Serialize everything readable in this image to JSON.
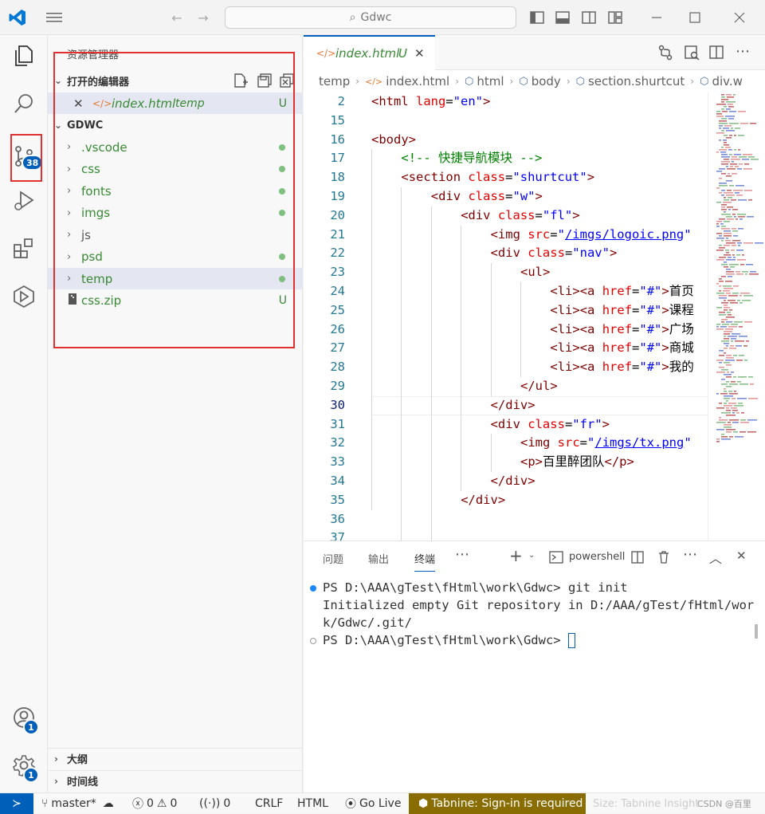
{
  "titlebar": {
    "search": "Gdwc"
  },
  "activity": {
    "scm_badge": "38",
    "account_badge": "1",
    "settings_badge": "1"
  },
  "explorer": {
    "title": "资源管理器",
    "open_editors": "打开的编辑器",
    "open_file": {
      "name": "index.html",
      "folder": "temp",
      "status": "U"
    },
    "root": "GDWC",
    "items": [
      {
        "label": ".vscode",
        "type": "folder",
        "dot": true
      },
      {
        "label": "css",
        "type": "folder",
        "dot": true
      },
      {
        "label": "fonts",
        "type": "folder",
        "dot": true
      },
      {
        "label": "imgs",
        "type": "folder",
        "dot": true
      },
      {
        "label": "js",
        "type": "folder",
        "dot": false
      },
      {
        "label": "psd",
        "type": "folder",
        "dot": true
      },
      {
        "label": "temp",
        "type": "folder",
        "dot": true
      },
      {
        "label": "css.zip",
        "type": "file",
        "status": "U"
      }
    ],
    "outline": "大纲",
    "timeline": "时间线"
  },
  "editor": {
    "tab": {
      "name": "index.html",
      "status": "U"
    },
    "breadcrumb": [
      "temp",
      "index.html",
      "html",
      "body",
      "section.shurtcut",
      "div.w"
    ],
    "lines": [
      {
        "n": "2",
        "indent": 0,
        "tokens": [
          [
            "t-tag",
            "<html "
          ],
          [
            "t-attr",
            "lang"
          ],
          [
            "t-txt",
            "="
          ],
          [
            "t-val",
            "\"en\""
          ],
          [
            "t-tag",
            ">"
          ]
        ]
      },
      {
        "n": "15",
        "indent": 0,
        "tokens": []
      },
      {
        "n": "16",
        "indent": 0,
        "tokens": [
          [
            "t-tag",
            "<body>"
          ]
        ]
      },
      {
        "n": "17",
        "indent": 1,
        "tokens": [
          [
            "t-com",
            "<!-- 快捷导航模块 -->"
          ]
        ]
      },
      {
        "n": "18",
        "indent": 1,
        "tokens": [
          [
            "t-tag",
            "<section "
          ],
          [
            "t-attr",
            "class"
          ],
          [
            "t-txt",
            "="
          ],
          [
            "t-val",
            "\"shurtcut\""
          ],
          [
            "t-tag",
            ">"
          ]
        ]
      },
      {
        "n": "19",
        "indent": 2,
        "tokens": [
          [
            "t-tag",
            "<div "
          ],
          [
            "t-attr",
            "class"
          ],
          [
            "t-txt",
            "="
          ],
          [
            "t-val",
            "\"w\""
          ],
          [
            "t-tag",
            ">"
          ]
        ]
      },
      {
        "n": "20",
        "indent": 3,
        "tokens": [
          [
            "t-tag",
            "<div "
          ],
          [
            "t-attr",
            "class"
          ],
          [
            "t-txt",
            "="
          ],
          [
            "t-val",
            "\"fl\""
          ],
          [
            "t-tag",
            ">"
          ]
        ]
      },
      {
        "n": "21",
        "indent": 4,
        "tokens": [
          [
            "t-tag",
            "<img "
          ],
          [
            "t-attr",
            "src"
          ],
          [
            "t-txt",
            "="
          ],
          [
            "t-val",
            "\""
          ],
          [
            "t-link",
            "/imgs/logoic.png"
          ],
          [
            "t-val",
            "\""
          ]
        ]
      },
      {
        "n": "22",
        "indent": 4,
        "tokens": [
          [
            "t-tag",
            "<div "
          ],
          [
            "t-attr",
            "class"
          ],
          [
            "t-txt",
            "="
          ],
          [
            "t-val",
            "\"nav\""
          ],
          [
            "t-tag",
            ">"
          ]
        ]
      },
      {
        "n": "23",
        "indent": 5,
        "tokens": [
          [
            "t-tag",
            "<ul>"
          ]
        ]
      },
      {
        "n": "24",
        "indent": 6,
        "tokens": [
          [
            "t-tag",
            "<li><a "
          ],
          [
            "t-attr",
            "href"
          ],
          [
            "t-txt",
            "="
          ],
          [
            "t-val",
            "\"#\""
          ],
          [
            "t-tag",
            ">"
          ],
          [
            "t-txt",
            "首页"
          ]
        ]
      },
      {
        "n": "25",
        "indent": 6,
        "tokens": [
          [
            "t-tag",
            "<li><a "
          ],
          [
            "t-attr",
            "href"
          ],
          [
            "t-txt",
            "="
          ],
          [
            "t-val",
            "\"#\""
          ],
          [
            "t-tag",
            ">"
          ],
          [
            "t-txt",
            "课程"
          ]
        ]
      },
      {
        "n": "26",
        "indent": 6,
        "tokens": [
          [
            "t-tag",
            "<li><a "
          ],
          [
            "t-attr",
            "href"
          ],
          [
            "t-txt",
            "="
          ],
          [
            "t-val",
            "\"#\""
          ],
          [
            "t-tag",
            ">"
          ],
          [
            "t-txt",
            "广场"
          ]
        ]
      },
      {
        "n": "27",
        "indent": 6,
        "tokens": [
          [
            "t-tag",
            "<li><a "
          ],
          [
            "t-attr",
            "href"
          ],
          [
            "t-txt",
            "="
          ],
          [
            "t-val",
            "\"#\""
          ],
          [
            "t-tag",
            ">"
          ],
          [
            "t-txt",
            "商城"
          ]
        ]
      },
      {
        "n": "28",
        "indent": 6,
        "tokens": [
          [
            "t-tag",
            "<li><a "
          ],
          [
            "t-attr",
            "href"
          ],
          [
            "t-txt",
            "="
          ],
          [
            "t-val",
            "\"#\""
          ],
          [
            "t-tag",
            ">"
          ],
          [
            "t-txt",
            "我的"
          ]
        ]
      },
      {
        "n": "29",
        "indent": 5,
        "tokens": [
          [
            "t-tag",
            "</ul>"
          ]
        ]
      },
      {
        "n": "30",
        "indent": 4,
        "tokens": [
          [
            "t-tag",
            "</div>"
          ]
        ],
        "current": true
      },
      {
        "n": "31",
        "indent": 4,
        "tokens": [
          [
            "t-tag",
            "<div "
          ],
          [
            "t-attr",
            "class"
          ],
          [
            "t-txt",
            "="
          ],
          [
            "t-val",
            "\"fr\""
          ],
          [
            "t-tag",
            ">"
          ]
        ]
      },
      {
        "n": "32",
        "indent": 5,
        "tokens": [
          [
            "t-tag",
            "<img "
          ],
          [
            "t-attr",
            "src"
          ],
          [
            "t-txt",
            "="
          ],
          [
            "t-val",
            "\""
          ],
          [
            "t-link",
            "/imgs/tx.png"
          ],
          [
            "t-val",
            "\""
          ]
        ]
      },
      {
        "n": "33",
        "indent": 5,
        "tokens": [
          [
            "t-tag",
            "<p>"
          ],
          [
            "t-txt",
            "百里醉团队"
          ],
          [
            "t-tag",
            "</p>"
          ]
        ]
      },
      {
        "n": "34",
        "indent": 4,
        "tokens": [
          [
            "t-tag",
            "</div>"
          ]
        ]
      },
      {
        "n": "35",
        "indent": 3,
        "tokens": [
          [
            "t-tag",
            "</div>"
          ]
        ]
      },
      {
        "n": "36",
        "indent": 0,
        "tokens": []
      },
      {
        "n": "37",
        "indent": 0,
        "tokens": []
      }
    ]
  },
  "panel": {
    "tabs": [
      "问题",
      "输出",
      "终端"
    ],
    "shell": "powershell",
    "terminal": [
      "PS D:\\AAA\\gTest\\fHtml\\work\\Gdwc> ",
      "git init",
      "Initialized empty Git repository in D:/AAA/gTest/fHtml/wor",
      "k/Gdwc/.git/",
      "PS D:\\AAA\\gTest\\fHtml\\work\\Gdwc> "
    ]
  },
  "status": {
    "branch": "master*",
    "errors": "0",
    "warnings": "0",
    "ports": "0",
    "eol": "CRLF",
    "lang": "HTML",
    "golive": "Go Live",
    "tabnine": "Tabnine: Sign-in is required",
    "extra": "Size: Tabnine Insight",
    "watermark": "CSDN @百里"
  },
  "colors": {
    "accent": "#005fb8",
    "added": "#388a34",
    "badge": "#005fb8",
    "highlight": "#e03131",
    "tabnine_bg": "#8a6d00"
  }
}
